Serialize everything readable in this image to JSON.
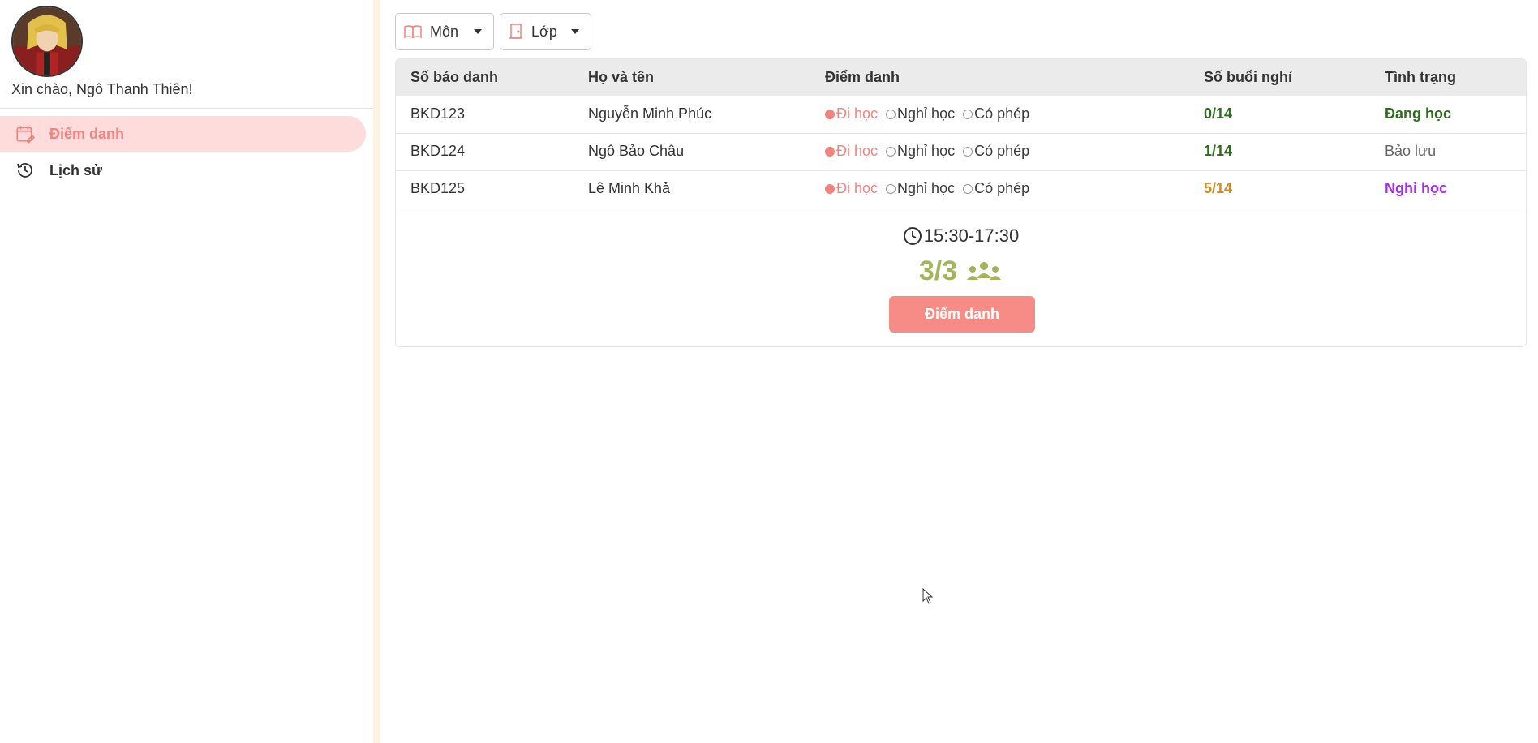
{
  "user": {
    "greeting": "Xin chào, Ngô Thanh Thiên!"
  },
  "sidebar": {
    "items": [
      {
        "label": "Điểm danh",
        "icon": "calendar-edit-icon",
        "active": true
      },
      {
        "label": "Lịch sử",
        "icon": "history-icon",
        "active": false
      }
    ]
  },
  "filters": {
    "subject": {
      "label": "Môn",
      "icon": "book-icon"
    },
    "class": {
      "label": "Lớp",
      "icon": "door-icon"
    }
  },
  "table": {
    "headers": [
      "Số báo danh",
      "Họ và tên",
      "Điểm danh",
      "Số buổi nghỉ",
      "Tình trạng"
    ],
    "attendance_options": [
      "Đi học",
      "Nghỉ học",
      "Có phép"
    ],
    "rows": [
      {
        "id": "BKD123",
        "name": "Nguyễn Minh Phúc",
        "selected": "Đi học",
        "absences": "0/14",
        "absences_color": "#2f6b1f",
        "status": "Đang học",
        "status_color": "#2f6b1f"
      },
      {
        "id": "BKD124",
        "name": "Ngô Bảo Châu",
        "selected": "Đi học",
        "absences": "1/14",
        "absences_color": "#2f6b1f",
        "status": "Bảo lưu",
        "status_color": "#666666"
      },
      {
        "id": "BKD125",
        "name": "Lê Minh Khả",
        "selected": "Đi học",
        "absences": "5/14",
        "absences_color": "#d18b1d",
        "status": "Nghỉ học",
        "status_color": "#a12ff0"
      }
    ]
  },
  "session": {
    "time": "15:30-17:30",
    "present_count": "3/3",
    "submit_label": "Điểm danh"
  },
  "colors": {
    "accent": "#f78b86",
    "accent_light": "#ffdcdc",
    "count": "#a4b45a",
    "divider": "#fdf3e4"
  }
}
